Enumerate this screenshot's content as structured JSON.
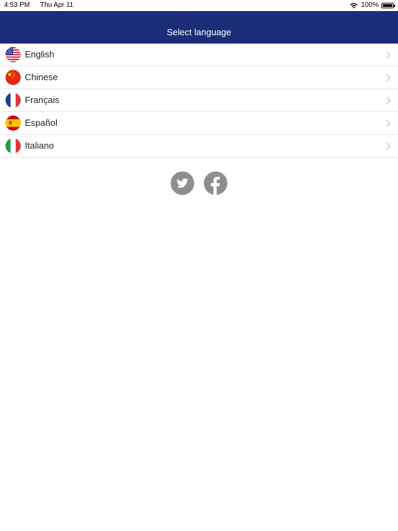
{
  "status_bar": {
    "time": "4:53 PM",
    "date": "Thu Apr 11",
    "battery": "100%",
    "icons": [
      "wifi-icon",
      "battery-icon"
    ]
  },
  "nav": {
    "title": "Select language"
  },
  "languages": [
    {
      "label": "English",
      "icon": "us-flag-icon"
    },
    {
      "label": "Chinese",
      "icon": "china-flag-icon"
    },
    {
      "label": "Français",
      "icon": "france-flag-icon"
    },
    {
      "label": "Español",
      "icon": "spain-flag-icon"
    },
    {
      "label": "Italiano",
      "icon": "italy-flag-icon"
    }
  ],
  "social": {
    "icons": [
      "twitter-icon",
      "facebook-icon"
    ]
  },
  "colors": {
    "nav_background": "#1b2d78",
    "social_icon": "#8e8e8e",
    "divider": "#e7e7e7"
  }
}
